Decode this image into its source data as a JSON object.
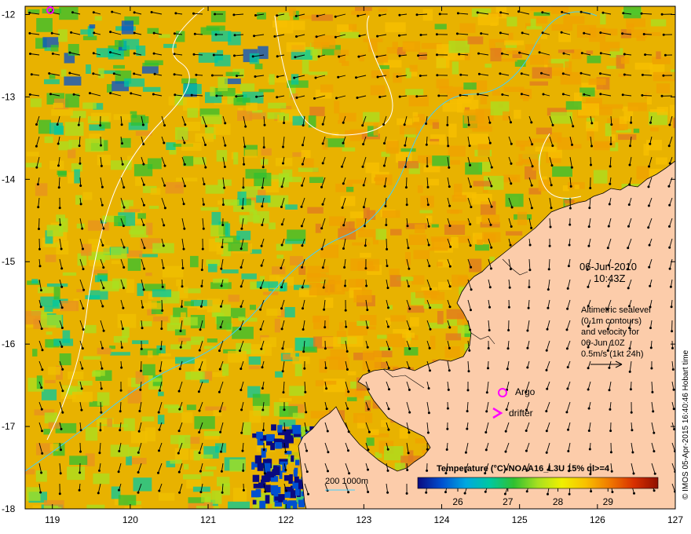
{
  "map": {
    "lon_ticks": [
      "119",
      "120",
      "121",
      "122",
      "123",
      "124",
      "125",
      "126",
      "127"
    ],
    "lat_ticks": [
      "-12",
      "-13",
      "-14",
      "-15",
      "-16",
      "-17",
      "-18"
    ],
    "lon_range": [
      118.65,
      127.0
    ],
    "lat_range": [
      -18.0,
      -11.9
    ],
    "ocean_color": "#e8b200",
    "land_color": "#fcccaa"
  },
  "annotations": {
    "date": "06-Jun-2010",
    "time": "10:43Z",
    "altimetry_line1": "Altimetric sealevel",
    "altimetry_line2": "(0.1m contours)",
    "altimetry_line3": "and velocity for",
    "altimetry_line4": "06-Jun 10Z",
    "velocity_scale": "0.5m/s (1kt 24h)",
    "argo_label": "Argo",
    "drifter_label": "drifter",
    "depth_label": "200  1000m",
    "credit": "© IMOS 05-Apr-2015 16:40:46 Hobart time"
  },
  "colorbar": {
    "title": "Temperature (°C) NOAA16_L3U 15% ql>=4",
    "tick_labels": [
      "26",
      "27",
      "28",
      "29"
    ],
    "tick_values": [
      26,
      27,
      28,
      29
    ],
    "range": [
      25.2,
      30.0
    ],
    "colors": [
      "#0a0a80",
      "#0050d0",
      "#00a8e0",
      "#00c8a0",
      "#30c030",
      "#a8e020",
      "#f0f000",
      "#f8c000",
      "#f07800",
      "#d83000",
      "#901000"
    ]
  },
  "colors": {
    "argo_marker": "#ff00ff",
    "drifter_marker": "#ff00ff",
    "contour_200": "#40d0ff",
    "contour_1000": "#ffffff"
  }
}
